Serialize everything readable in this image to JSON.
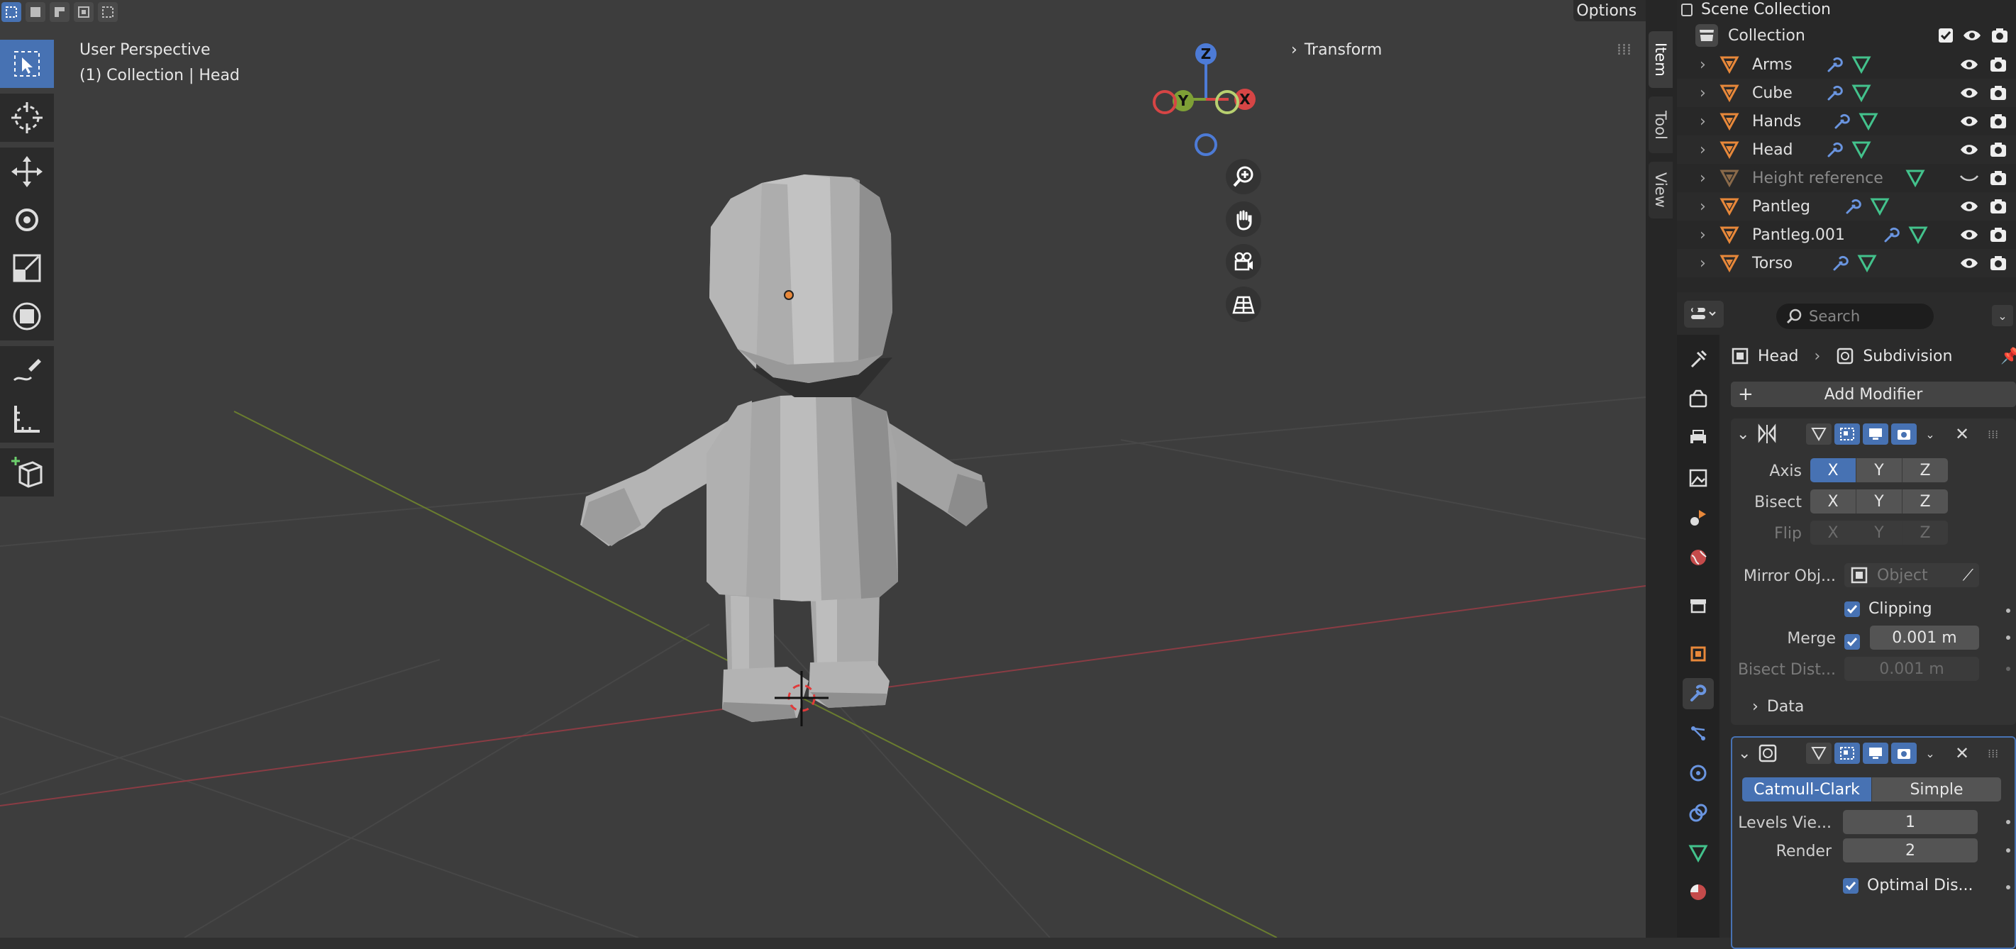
{
  "viewport": {
    "perspective": "User Perspective",
    "collection_info": "(1) Collection | Head",
    "options_label": "Options",
    "transform_label": "Transform",
    "gizmo": {
      "z": "Z",
      "y": "Y",
      "x": "X"
    },
    "side_tabs": [
      "Item",
      "Tool",
      "View"
    ]
  },
  "outliner": {
    "header": "Scene Collection",
    "collection": "Collection",
    "items": [
      {
        "name": "Arms",
        "visible": true
      },
      {
        "name": "Cube",
        "visible": true
      },
      {
        "name": "Hands",
        "visible": true
      },
      {
        "name": "Head",
        "visible": true
      },
      {
        "name": "Height reference",
        "visible": false
      },
      {
        "name": "Pantleg",
        "visible": true
      },
      {
        "name": "Pantleg.001",
        "visible": true
      },
      {
        "name": "Torso",
        "visible": true
      }
    ]
  },
  "properties": {
    "search_placeholder": "Search",
    "breadcrumb": {
      "object": "Head",
      "modifier": "Subdivision"
    },
    "add_modifier": "Add Modifier",
    "mirror": {
      "axis_label": "Axis",
      "bisect_label": "Bisect",
      "flip_label": "Flip",
      "axes": [
        "X",
        "Y",
        "Z"
      ],
      "mirror_obj_label": "Mirror Obj...",
      "mirror_obj_placeholder": "Object",
      "clipping_label": "Clipping",
      "merge_label": "Merge",
      "merge_value": "0.001 m",
      "bisect_dist_label": "Bisect Dist...",
      "bisect_dist_value": "0.001 m",
      "data_label": "Data"
    },
    "subdivision": {
      "catmull_label": "Catmull-Clark",
      "simple_label": "Simple",
      "levels_label": "Levels Vie...",
      "levels_value": "1",
      "render_label": "Render",
      "render_value": "2",
      "optimal_label": "Optimal Dis..."
    }
  },
  "colors": {
    "accent": "#4772b3",
    "viewport_bg": "#3d3d3d",
    "orange": "#e8883a",
    "x_axis": "#d64545",
    "y_axis": "#7ea036",
    "z_axis": "#4d7bd6"
  }
}
